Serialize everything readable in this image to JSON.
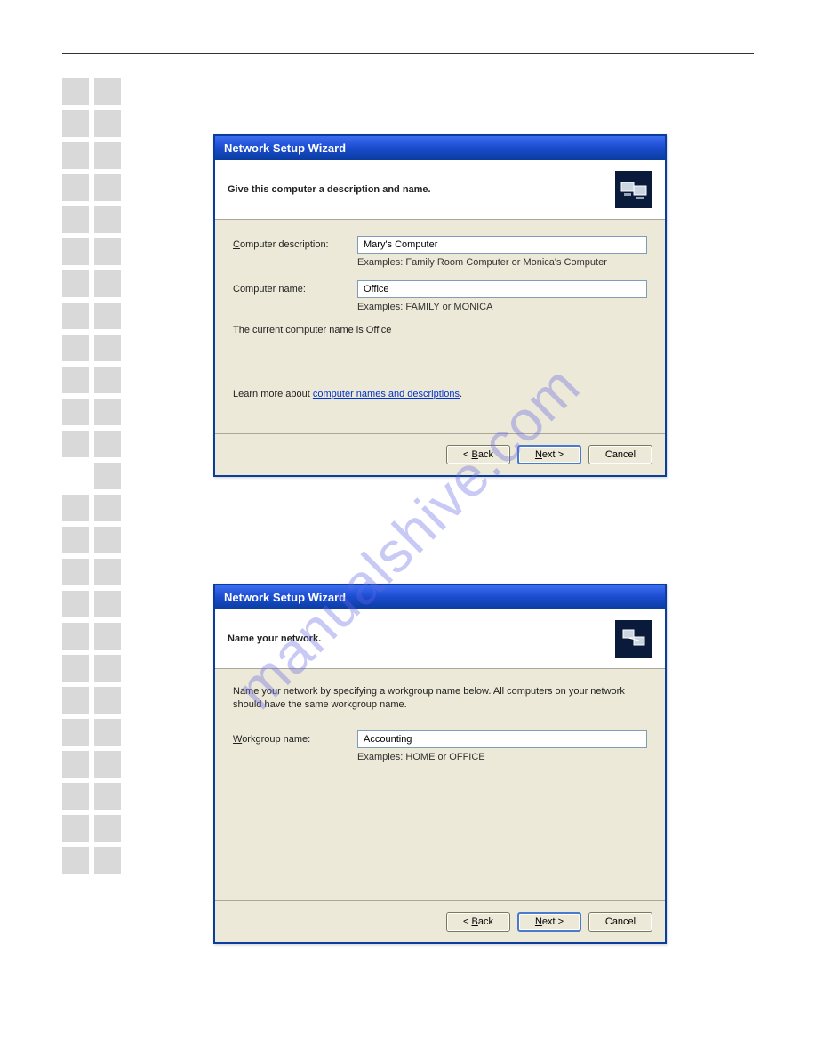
{
  "watermark": "manualshive.com",
  "dialog1": {
    "title": "Network Setup Wizard",
    "heading": "Give this computer a description and name.",
    "description_label_pre": "C",
    "description_label_rest": "omputer description:",
    "description_value": "Mary's Computer",
    "description_example": "Examples: Family Room Computer or Monica's Computer",
    "name_label": "Computer name:",
    "name_value": "Office",
    "name_example": "Examples: FAMILY or MONICA",
    "current_name_text": "The current computer name is Office",
    "learn_more_prefix": "Learn more about ",
    "learn_more_link": "computer names and descriptions",
    "learn_more_suffix": ".",
    "back_label": "< Back",
    "next_label": "Next >",
    "cancel_label": "Cancel"
  },
  "dialog2": {
    "title": "Network Setup Wizard",
    "heading": "Name your network.",
    "intro": "Name your network by specifying a workgroup name below. All computers on your network should have the same workgroup name.",
    "workgroup_label_pre": "W",
    "workgroup_label_rest": "orkgroup name:",
    "workgroup_value": "Accounting",
    "workgroup_example": "Examples: HOME or OFFICE",
    "back_label": "< Back",
    "next_label": "Next >",
    "cancel_label": "Cancel"
  }
}
